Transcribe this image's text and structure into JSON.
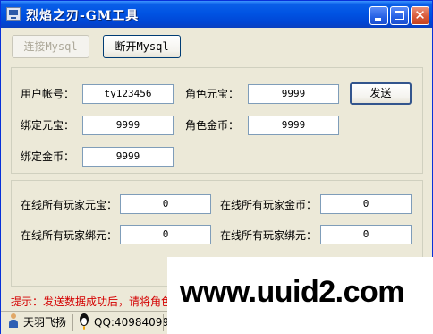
{
  "window": {
    "title": "烈焰之刃-GM工具"
  },
  "toolbar": {
    "connect_label": "连接Mysql",
    "disconnect_label": "断开Mysql"
  },
  "top_group": {
    "account_label": "用户帐号：",
    "account_value": "ty123456",
    "role_ingot_label": "角色元宝：",
    "role_ingot_value": "9999",
    "send_label": "发送",
    "bound_ingot_label": "绑定元宝：",
    "bound_ingot_value": "9999",
    "role_gold_label": "角色金币：",
    "role_gold_value": "9999",
    "bound_gold_label": "绑定金币：",
    "bound_gold_value": "9999"
  },
  "bottom_group": {
    "all_ingot_label": "在线所有玩家元宝：",
    "all_ingot_value": "0",
    "all_gold_label": "在线所有玩家金币：",
    "all_gold_value": "0",
    "all_bound_left_label": "在线所有玩家绑元：",
    "all_bound_left_value": "0",
    "all_bound_right_label": "在线所有玩家绑元：",
    "all_bound_right_value": "0"
  },
  "hint": "提示：发送数据成功后，请将角色",
  "statusbar": {
    "author": "天羽飞扬",
    "qq": "QQ:409840991"
  },
  "watermark": "www.uuid2.com",
  "colors": {
    "titlebar": "#0054e3",
    "window_bg": "#ece9d8",
    "hint_text": "#d40000",
    "close_button": "#d95a3a"
  },
  "icons": [
    "app-icon",
    "minimize-icon",
    "maximize-icon",
    "close-icon",
    "person-icon",
    "penguin-icon"
  ]
}
